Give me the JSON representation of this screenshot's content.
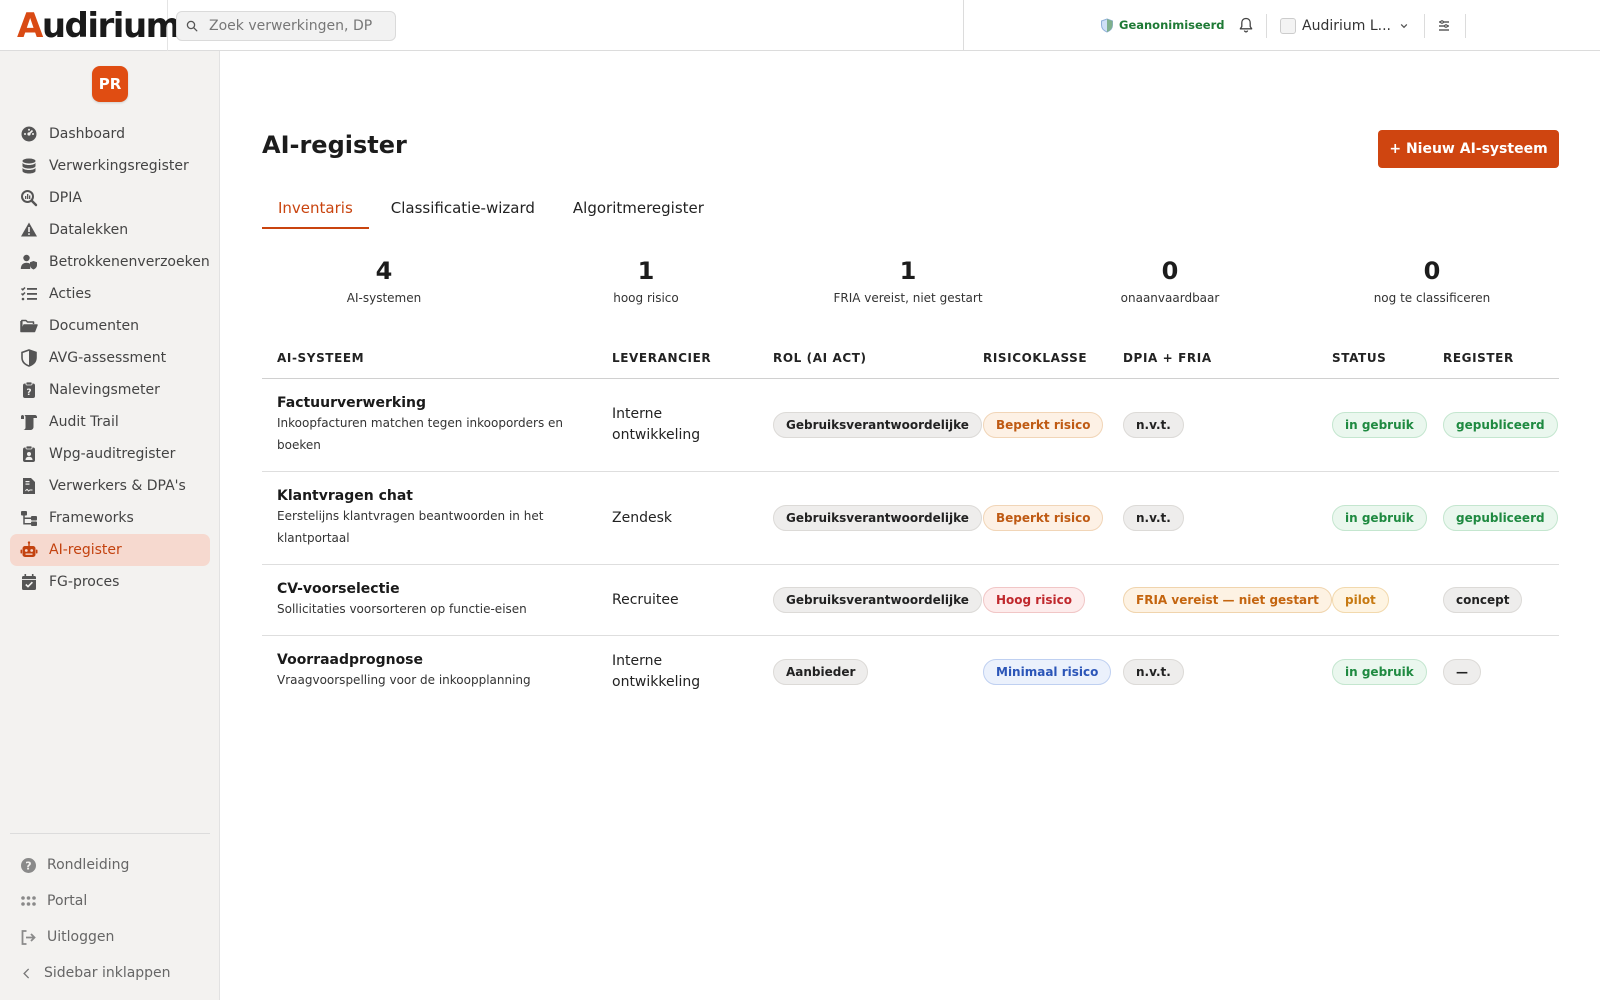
{
  "app": {
    "logo_prefix": "A",
    "logo_rest": "udirium",
    "search_placeholder": "Zoek verwerkingen, DP",
    "anonymized_label": "Geanonimiseerd",
    "org_name": "Audirium L..."
  },
  "user": {
    "initials": "PR"
  },
  "sidebar": {
    "items": [
      {
        "label": "Dashboard",
        "icon": "dashboard-icon"
      },
      {
        "label": "Verwerkingsregister",
        "icon": "database-icon"
      },
      {
        "label": "DPIA",
        "icon": "search-chart-icon"
      },
      {
        "label": "Datalekken",
        "icon": "warning-icon"
      },
      {
        "label": "Betrokkenenverzoeken",
        "icon": "user-shield-icon"
      },
      {
        "label": "Acties",
        "icon": "list-check-icon"
      },
      {
        "label": "Documenten",
        "icon": "folder-icon"
      },
      {
        "label": "AVG-assessment",
        "icon": "shield-half-icon"
      },
      {
        "label": "Nalevingsmeter",
        "icon": "clipboard-question-icon"
      },
      {
        "label": "Audit Trail",
        "icon": "scroll-icon"
      },
      {
        "label": "Wpg-auditregister",
        "icon": "clipboard-user-icon"
      },
      {
        "label": "Verwerkers & DPA's",
        "icon": "file-contract-icon"
      },
      {
        "label": "Frameworks",
        "icon": "sitemap-icon"
      },
      {
        "label": "AI-register",
        "icon": "robot-icon",
        "active": true
      },
      {
        "label": "FG-proces",
        "icon": "calendar-check-icon"
      }
    ],
    "bottom": [
      {
        "label": "Rondleiding",
        "icon": "question-circle-icon"
      },
      {
        "label": "Portal",
        "icon": "grid-icon"
      },
      {
        "label": "Uitloggen",
        "icon": "logout-icon"
      },
      {
        "label": "Sidebar inklappen",
        "icon": "chevron-left-icon"
      }
    ]
  },
  "page": {
    "title": "AI-register",
    "new_button": "+ Nieuw AI-systeem",
    "tabs": [
      {
        "label": "Inventaris",
        "active": true
      },
      {
        "label": "Classificatie-wizard"
      },
      {
        "label": "Algoritmeregister"
      }
    ],
    "stats": [
      {
        "value": "4",
        "label": "AI-systemen"
      },
      {
        "value": "1",
        "label": "hoog risico"
      },
      {
        "value": "1",
        "label": "FRIA vereist, niet gestart"
      },
      {
        "value": "0",
        "label": "onaanvaardbaar"
      },
      {
        "value": "0",
        "label": "nog te classificeren"
      }
    ]
  },
  "table": {
    "headers": [
      "AI-SYSTEEM",
      "LEVERANCIER",
      "ROL (AI ACT)",
      "RISICOKLASSE",
      "DPIA + FRIA",
      "STATUS",
      "REGISTER"
    ],
    "rows": [
      {
        "name": "Factuurverwerking",
        "description": "Inkoopfacturen matchen tegen inkooporders en boeken",
        "vendor": "Interne ontwikkeling",
        "role": "Gebruiksverantwoordelijke",
        "risk": "Beperkt risico",
        "risk_tone": "orange",
        "dpia": "n.v.t.",
        "dpia_tone": "gray",
        "status": "in gebruik",
        "status_tone": "green",
        "register": "gepubliceerd",
        "register_tone": "green"
      },
      {
        "name": "Klantvragen chat",
        "description": "Eerstelijns klantvragen beantwoorden in het klantportaal",
        "vendor": "Zendesk",
        "role": "Gebruiksverantwoordelijke",
        "risk": "Beperkt risico",
        "risk_tone": "orange",
        "dpia": "n.v.t.",
        "dpia_tone": "gray",
        "status": "in gebruik",
        "status_tone": "green",
        "register": "gepubliceerd",
        "register_tone": "green"
      },
      {
        "name": "CV-voorselectie",
        "description": "Sollicitaties voorsorteren op functie-eisen",
        "vendor": "Recruitee",
        "role": "Gebruiksverantwoordelijke",
        "risk": "Hoog risico",
        "risk_tone": "red",
        "dpia": "FRIA vereist — niet gestart",
        "dpia_tone": "amber",
        "status": "pilot",
        "status_tone": "amber2",
        "register": "concept",
        "register_tone": "gray"
      },
      {
        "name": "Voorraadprognose",
        "description": "Vraagvoorspelling voor de inkoopplanning",
        "vendor": "Interne ontwikkeling",
        "role": "Aanbieder",
        "risk": "Minimaal risico",
        "risk_tone": "blue",
        "dpia": "n.v.t.",
        "dpia_tone": "gray",
        "status": "in gebruik",
        "status_tone": "green",
        "register": "—",
        "register_tone": "gray"
      }
    ]
  },
  "colors": {
    "brand": "#cf4510",
    "active_nav_bg": "#f6d9cf",
    "anonymized_green": "#1e7a35"
  }
}
